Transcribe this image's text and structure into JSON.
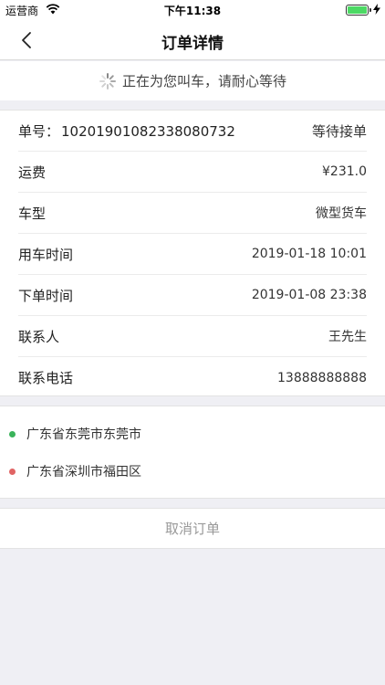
{
  "status_bar": {
    "carrier": "运营商",
    "time": "下午11:38",
    "battery_level": 1.0
  },
  "nav": {
    "title": "订单详情"
  },
  "waiting": {
    "text": "正在为您叫车，请耐心等待"
  },
  "order": {
    "number_label": "单号：",
    "number": "10201901082338080732",
    "status": "等待接单",
    "rows": [
      {
        "label": "运费",
        "value": "¥231.0"
      },
      {
        "label": "车型",
        "value": "微型货车"
      },
      {
        "label": "用车时间",
        "value": "2019-01-18 10:01"
      },
      {
        "label": "下单时间",
        "value": "2019-01-08 23:38"
      },
      {
        "label": "联系人",
        "value": "王先生"
      },
      {
        "label": "联系电话",
        "value": "13888888888"
      }
    ]
  },
  "addresses": [
    {
      "text": "广东省东莞市东莞市",
      "color": "#3ab35a"
    },
    {
      "text": "广东省深圳市福田区",
      "color": "#e06464"
    }
  ],
  "actions": {
    "cancel_label": "取消订单"
  },
  "colors": {
    "background": "#efeff4",
    "battery": "#4cd964",
    "start_dot": "#3ab35a",
    "end_dot": "#e06464"
  }
}
